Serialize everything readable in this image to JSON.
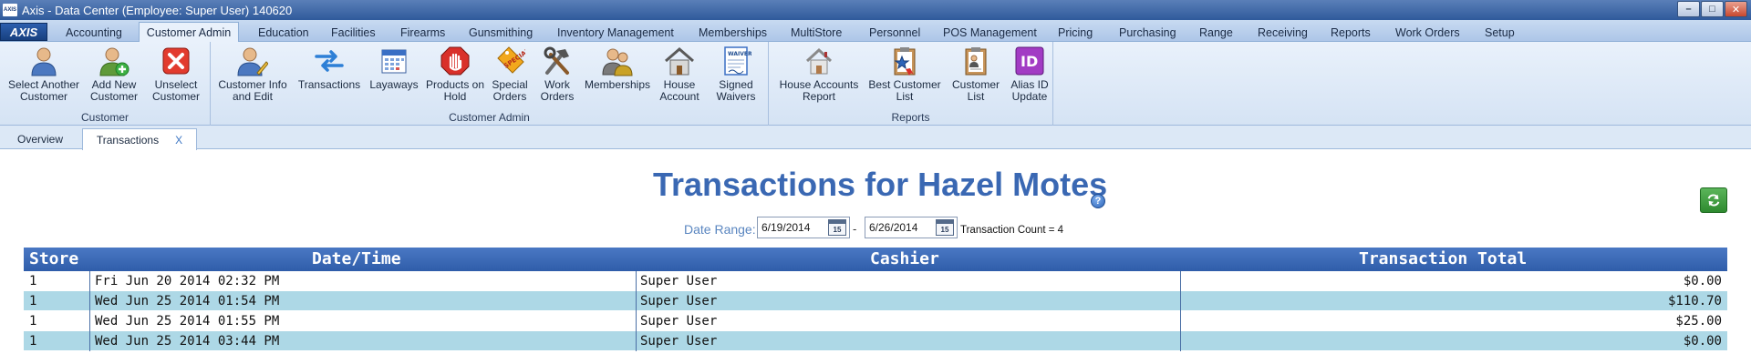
{
  "window": {
    "app_icon": "AXIS",
    "title": "Axis - Data Center  (Employee: Super User) 140620"
  },
  "menu": {
    "logo": "AXIS",
    "tabs": [
      "Accounting",
      "Customer Admin",
      "Education",
      "Facilities",
      "Firearms",
      "Gunsmithing",
      "Inventory Management",
      "Memberships",
      "MultiStore",
      "Personnel",
      "POS Management",
      "Pricing",
      "Purchasing",
      "Range",
      "Receiving",
      "Reports",
      "Work Orders",
      "Setup"
    ],
    "active_tab": "Customer Admin"
  },
  "ribbon": {
    "groups": [
      {
        "label": "Customer",
        "buttons": [
          {
            "label": "Select Another\nCustomer",
            "icon": "person-select-icon"
          },
          {
            "label": "Add New\nCustomer",
            "icon": "person-add-icon"
          },
          {
            "label": "Unselect\nCustomer",
            "icon": "red-x-icon"
          }
        ]
      },
      {
        "label": "Customer Admin",
        "buttons": [
          {
            "label": "Customer Info\nand Edit",
            "icon": "person-edit-icon"
          },
          {
            "label": "Transactions",
            "icon": "arrows-exchange-icon"
          },
          {
            "label": "Layaways",
            "icon": "calendar-icon"
          },
          {
            "label": "Products on\nHold",
            "icon": "stop-hand-icon"
          },
          {
            "label": "Special\nOrders",
            "icon": "special-tag-icon"
          },
          {
            "label": "Work\nOrders",
            "icon": "tools-icon"
          },
          {
            "label": "Memberships",
            "icon": "people-icon"
          },
          {
            "label": "House\nAccount",
            "icon": "house-icon"
          },
          {
            "label": "Signed\nWaivers",
            "icon": "waiver-document-icon"
          }
        ]
      },
      {
        "label": "Reports",
        "buttons": [
          {
            "label": "House Accounts\nReport",
            "icon": "house-report-icon"
          },
          {
            "label": "Best Customer\nList",
            "icon": "award-clipboard-icon"
          },
          {
            "label": "Customer\nList",
            "icon": "clipboard-list-icon"
          },
          {
            "label": "Alias ID\nUpdate",
            "icon": "id-badge-icon"
          }
        ]
      }
    ]
  },
  "doc_tabs": {
    "overview": "Overview",
    "transactions": "Transactions",
    "close": "X"
  },
  "content": {
    "title": "Transactions for Hazel Motes",
    "help": "?",
    "date_range_label": "Date Range:",
    "date_from": "6/19/2014",
    "date_to": "6/26/2014",
    "calendar_day": "15",
    "separator": "-",
    "transaction_count": "Transaction Count = 4"
  },
  "table": {
    "columns": [
      "Store",
      "Date/Time",
      "Cashier",
      "Transaction Total"
    ],
    "rows": [
      {
        "store": "1",
        "datetime": "Fri Jun 20 2014 02:32 PM",
        "cashier": "Super User",
        "total": "$0.00"
      },
      {
        "store": "1",
        "datetime": "Wed Jun 25 2014 01:54 PM",
        "cashier": "Super User",
        "total": "$110.70"
      },
      {
        "store": "1",
        "datetime": "Wed Jun 25 2014 01:55 PM",
        "cashier": "Super User",
        "total": "$25.00"
      },
      {
        "store": "1",
        "datetime": "Wed Jun 25 2014 03:44 PM",
        "cashier": "Super User",
        "total": "$0.00"
      }
    ]
  },
  "colors": {
    "title_blue": "#3a68b3",
    "header_blue": "#2f5daa",
    "alt_row": "#add8e6",
    "refresh_green": "#2e8a2f"
  }
}
